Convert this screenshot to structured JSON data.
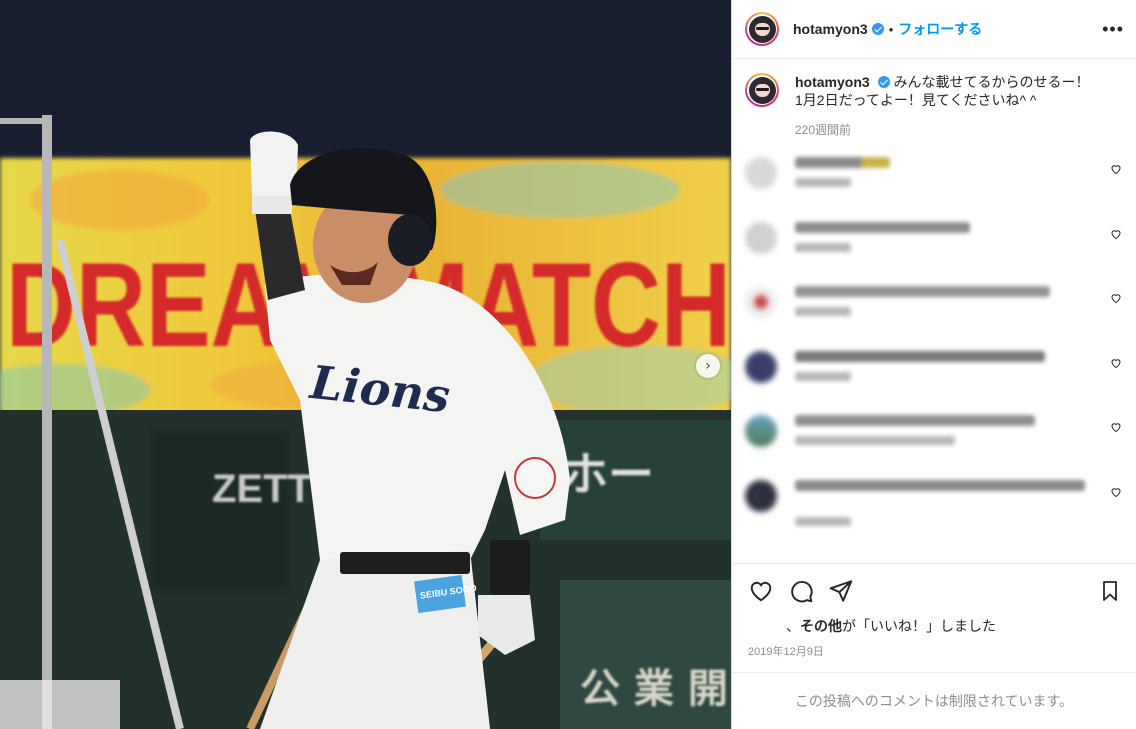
{
  "photo": {
    "banner_text": "DREAM MATCH",
    "jersey_text": "Lions",
    "sign_text_1": "ZETT",
    "sign_text_2": "ホー",
    "sign_text_3": "公 業 開",
    "sponsor_patch": "SEIBU SOGO",
    "next_icon": "chevron-right-icon"
  },
  "header": {
    "username": "hotamyon3",
    "separator": "•",
    "follow_label": "フォローする",
    "more_icon": "more-horizontal-icon"
  },
  "caption": {
    "username": "hotamyon3",
    "line1": "みんな載せてるからのせるー！",
    "line2": "1月2日だってよー！見てくださいね^ ^",
    "time": "220週間前"
  },
  "comments": [
    {
      "avatar_color": "#d8d8d8"
    },
    {
      "avatar_color": "#d0d0d0"
    },
    {
      "avatar_color": "#c94a4a"
    },
    {
      "avatar_color": "#3a3f6a"
    },
    {
      "avatar_color": "#5b8aa6"
    },
    {
      "avatar_color": "#2f3140"
    }
  ],
  "actions": {
    "like_icon": "heart-icon",
    "comment_icon": "comment-icon",
    "share_icon": "send-icon",
    "save_icon": "bookmark-icon",
    "likes_prefix": "、",
    "likes_bold": "その他",
    "likes_suffix": "が「いいね！」しました",
    "date": "2019年12月9日"
  },
  "footer": {
    "restricted_text": "この投稿へのコメントは制限されています。"
  },
  "colors": {
    "accent": "#0095f6",
    "verified": "#3897f0",
    "muted": "#8e8e8e"
  }
}
